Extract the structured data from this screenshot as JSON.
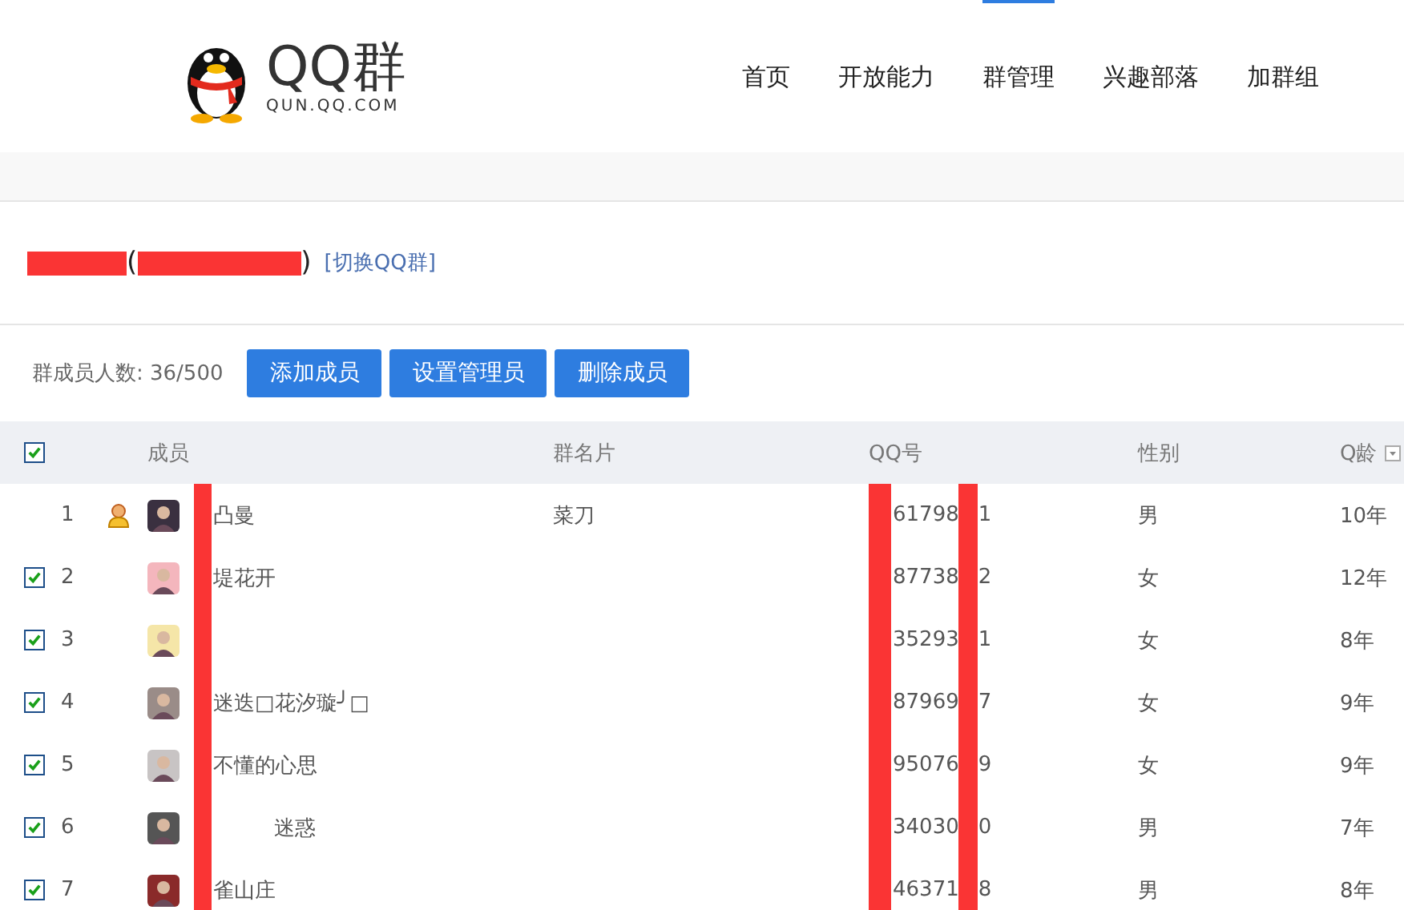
{
  "logo": {
    "title": "QQ群",
    "subtitle": "QUN.QQ.COM"
  },
  "nav": [
    {
      "label": "首页",
      "selected": false
    },
    {
      "label": "开放能力",
      "selected": false
    },
    {
      "label": "群管理",
      "selected": true
    },
    {
      "label": "兴趣部落",
      "selected": false
    },
    {
      "label": "加群组",
      "selected": false
    }
  ],
  "group": {
    "open": "(",
    "close": ")",
    "switch_link": "[切换QQ群]"
  },
  "toolbar": {
    "count": "群成员人数: 36/500",
    "buttons": [
      "添加成员",
      "设置管理员",
      "删除成员"
    ]
  },
  "table": {
    "select_all": true,
    "columns": [
      "成员",
      "群名片",
      "QQ号",
      "性别",
      "Q龄"
    ],
    "rows": [
      {
        "index": "1",
        "checked": false,
        "admin": true,
        "name": "凸曼",
        "card": "菜刀",
        "qq": [
          "61798",
          "1"
        ],
        "gender": "男",
        "age": "10年"
      },
      {
        "index": "2",
        "checked": true,
        "admin": false,
        "name": "堤花开",
        "qq": [
          "87738",
          "2"
        ],
        "gender": "女",
        "age": "12年"
      },
      {
        "index": "3",
        "checked": true,
        "admin": false,
        "qq": [
          "35293",
          "1"
        ],
        "gender": "女",
        "age": "8年"
      },
      {
        "index": "4",
        "checked": true,
        "admin": false,
        "name": "迷迭□花汐璇╯□",
        "qq": [
          "87969",
          "7"
        ],
        "gender": "女",
        "age": "9年"
      },
      {
        "index": "5",
        "checked": true,
        "admin": false,
        "name": "不懂的心思",
        "qq": [
          "95076",
          "9"
        ],
        "gender": "女",
        "age": "9年"
      },
      {
        "index": "6",
        "checked": true,
        "admin": false,
        "name": "迷惑",
        "indent": true,
        "qq": [
          "34030",
          "0"
        ],
        "gender": "男",
        "age": "7年"
      },
      {
        "index": "7",
        "checked": true,
        "admin": false,
        "name": "雀山庄",
        "qq": [
          "46371",
          "8"
        ],
        "gender": "男",
        "age": "8年"
      }
    ]
  }
}
